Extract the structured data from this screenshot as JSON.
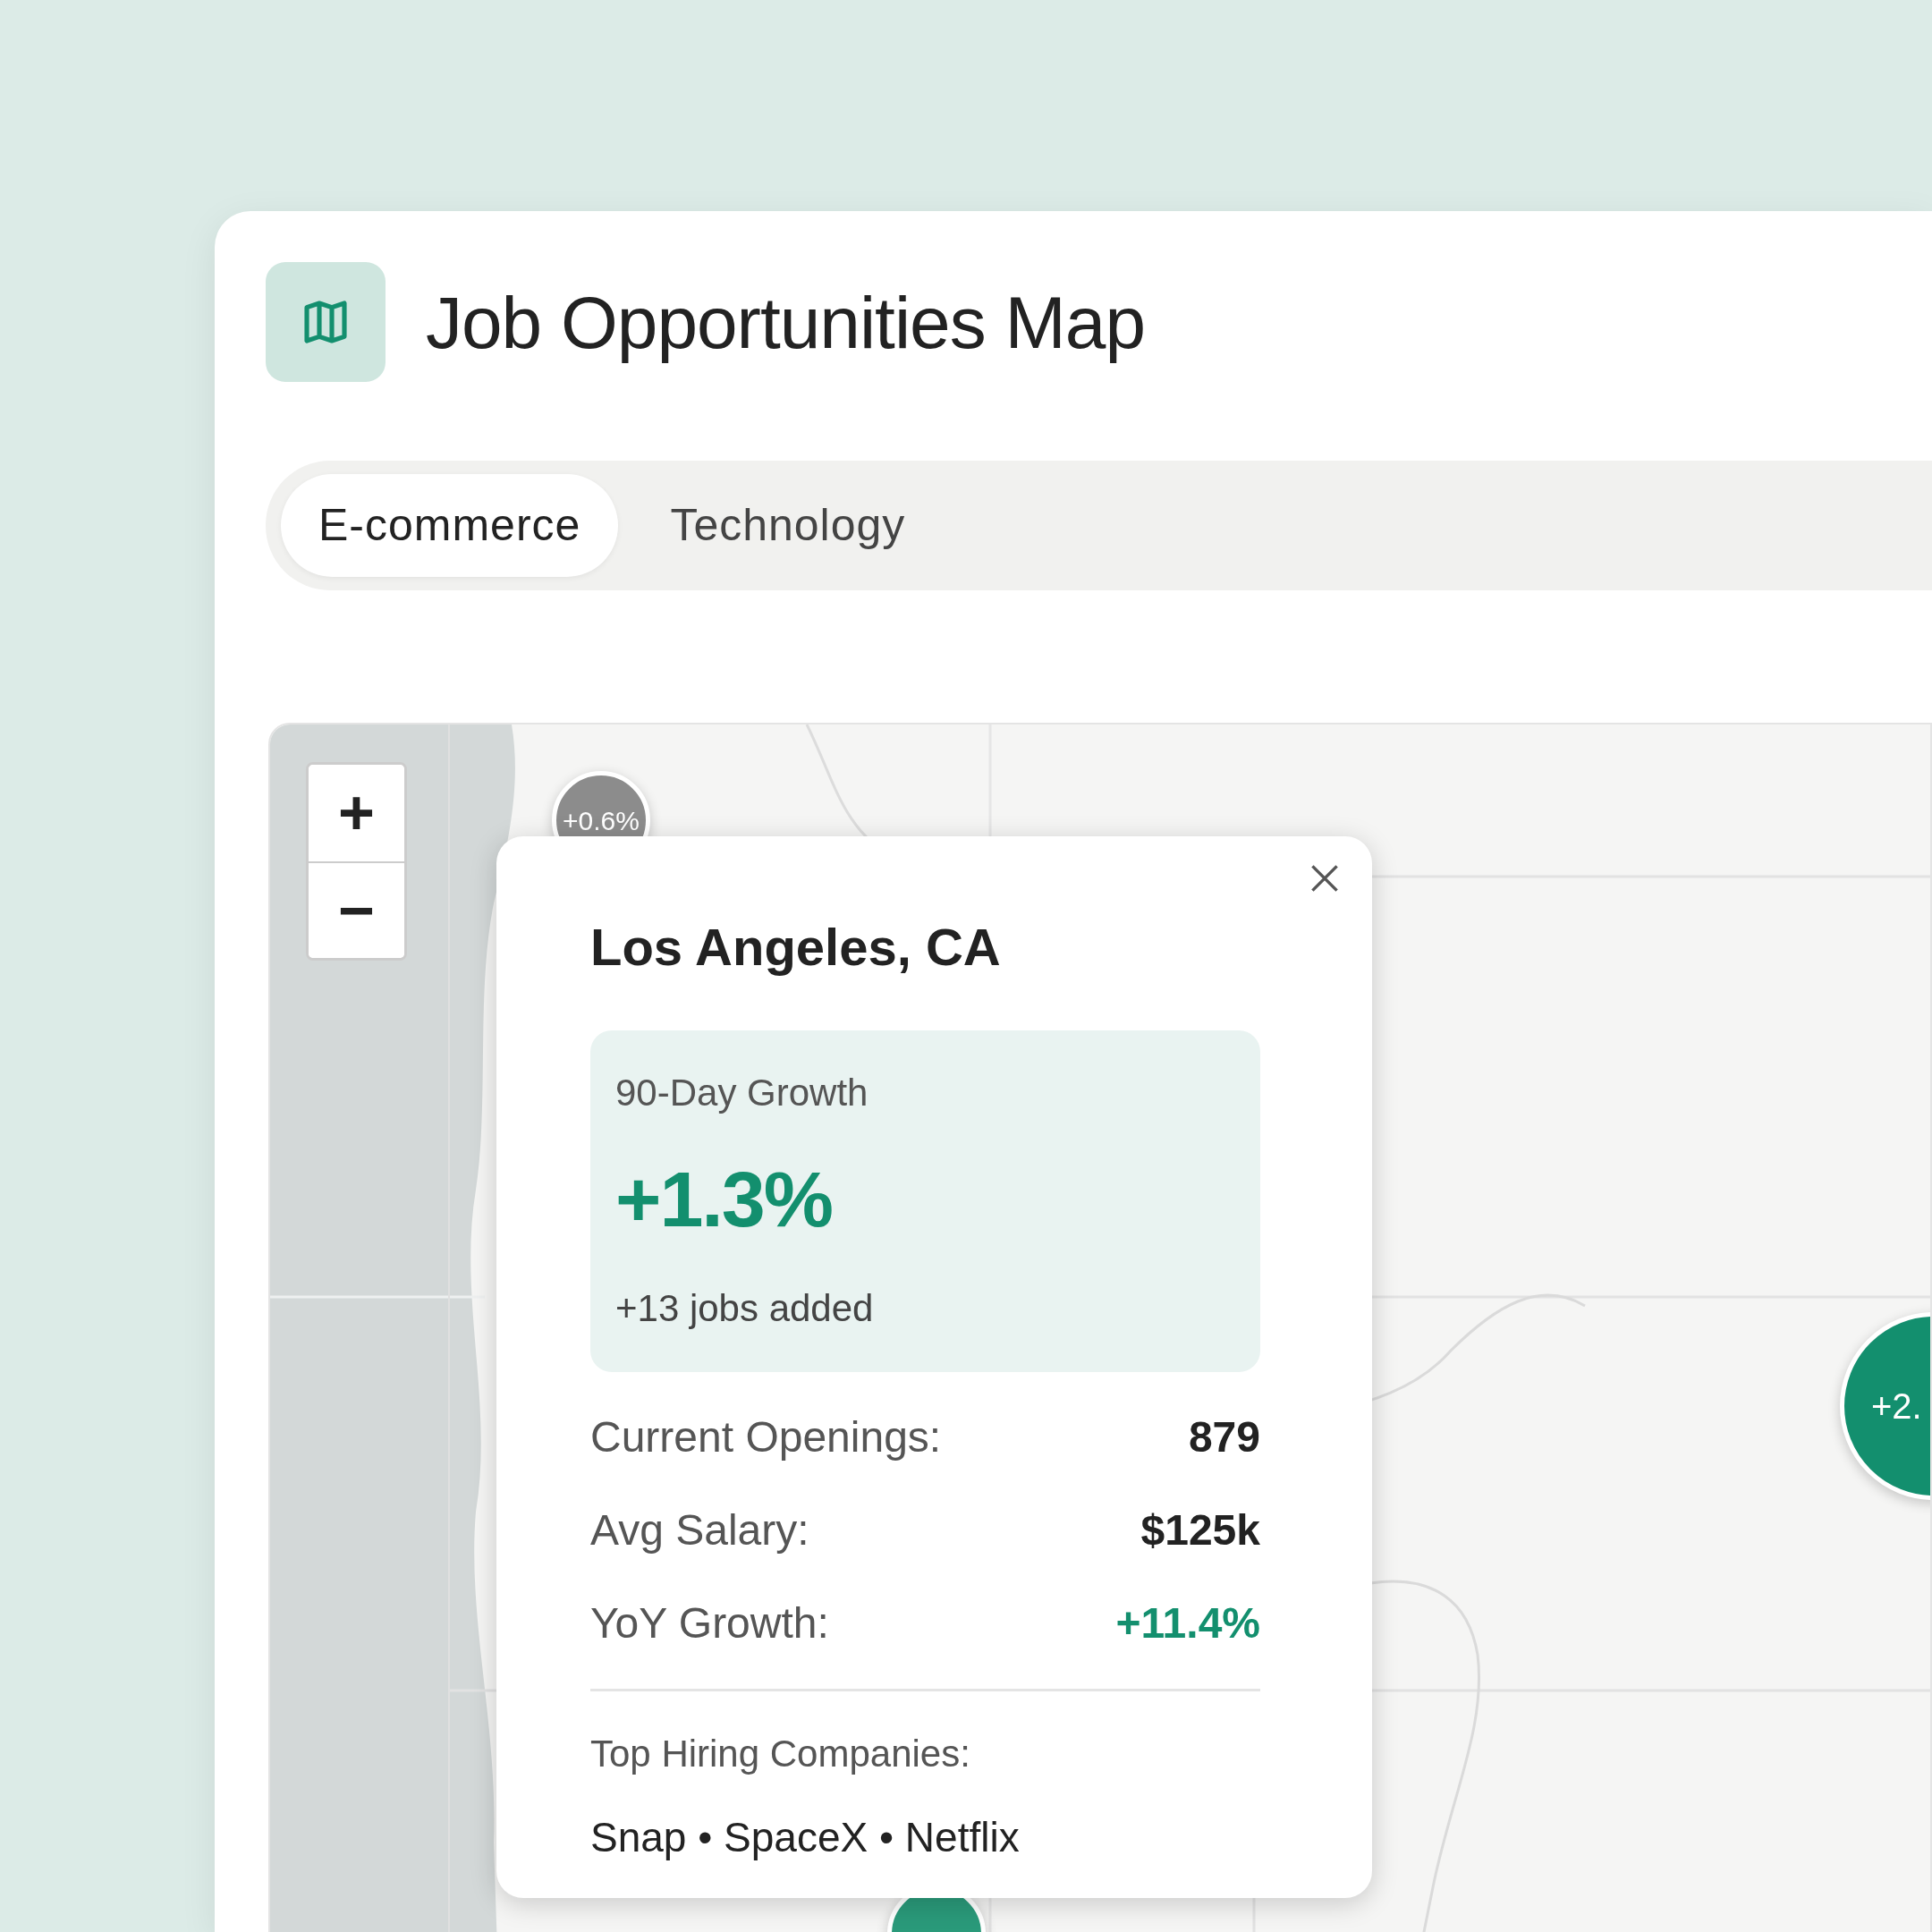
{
  "header": {
    "title": "Job Opportunities Map"
  },
  "tabs": [
    {
      "label": "E-commerce",
      "selected": true
    },
    {
      "label": "Technology",
      "selected": false
    }
  ],
  "map": {
    "kind": "picture",
    "zoom": [
      "+",
      "−"
    ],
    "markers": [
      {
        "label": "+0.6%",
        "color": "#8c8c8c"
      },
      {
        "label": "+2.",
        "color": "#138f6e"
      },
      {
        "color": "#2a9a7a"
      }
    ],
    "popup": {
      "title": "Los Angeles, CA",
      "growth": {
        "label": "90-Day Growth",
        "value": "+1.3%",
        "note": "+13 jobs added"
      },
      "stats": [
        {
          "label": "Current Openings:",
          "value": "879",
          "kind": "plain"
        },
        {
          "label": "Avg Salary:",
          "value": "$125k",
          "kind": "plain"
        },
        {
          "label": "YoY Growth:",
          "value": "+11.4%",
          "kind": "positive"
        }
      ],
      "companies_label": "Top Hiring Companies:",
      "companies": "Snap • SpaceX • Netflix"
    }
  }
}
